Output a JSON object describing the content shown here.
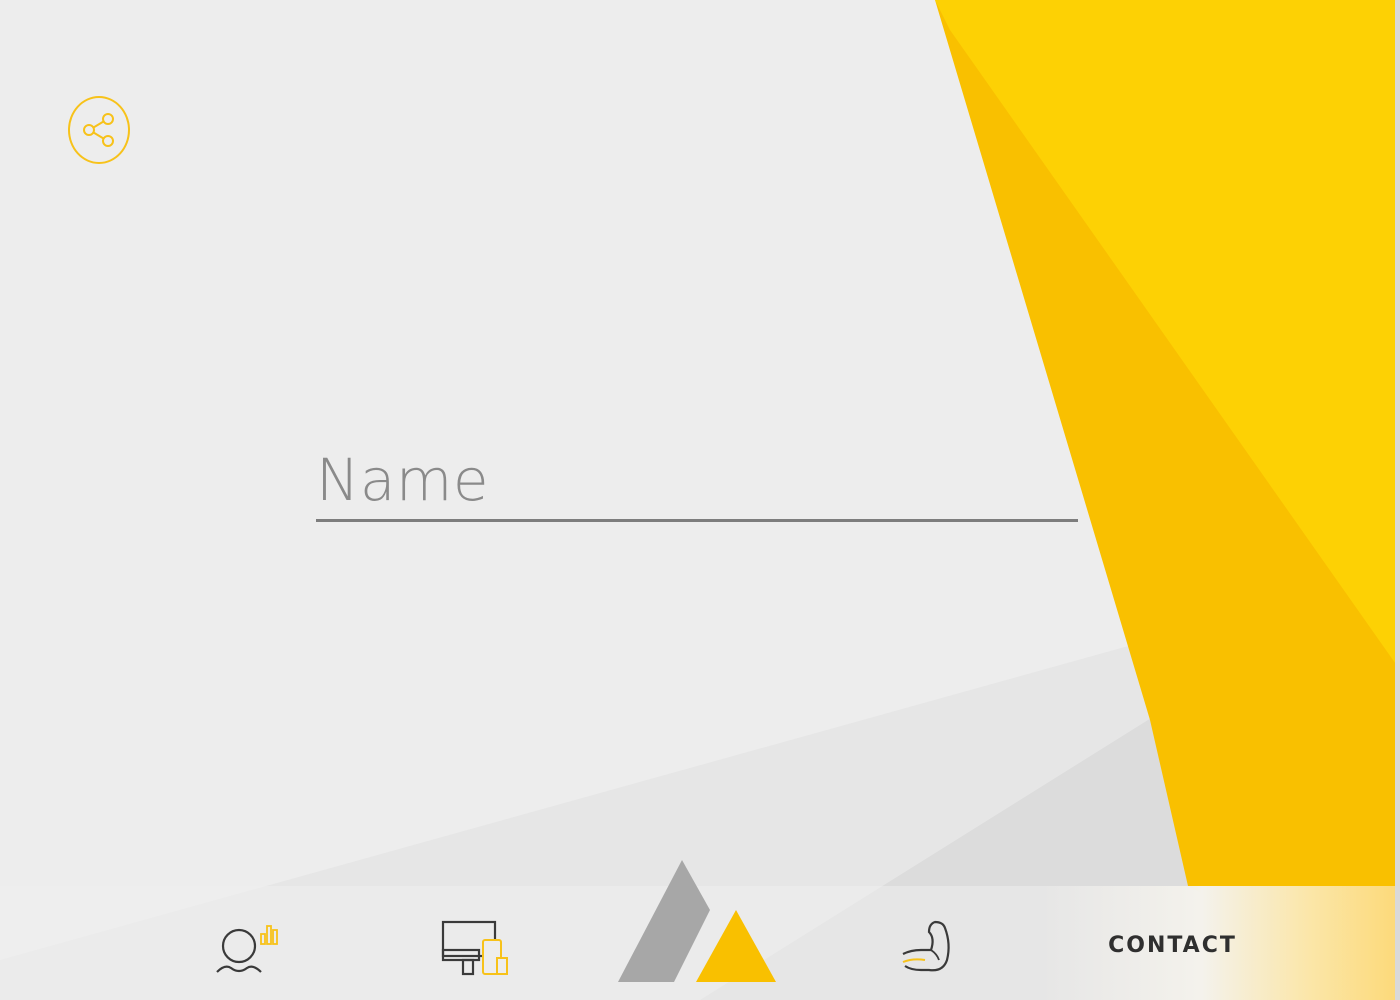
{
  "colors": {
    "background": "#ededed",
    "accent_light": "#fdd104",
    "accent_dark": "#f9c000",
    "logo_gray": "#a7a7a7",
    "line_gray": "#7d7d7d"
  },
  "share": {
    "icon": "share-icon"
  },
  "form": {
    "name_placeholder": "Name",
    "name_value": ""
  },
  "nav": {
    "items": [
      {
        "icon": "profile-stats-icon"
      },
      {
        "icon": "devices-icon"
      },
      {
        "icon": "logo-icon"
      },
      {
        "icon": "flexed-arm-icon"
      }
    ],
    "contact_label": "CONTACT"
  }
}
